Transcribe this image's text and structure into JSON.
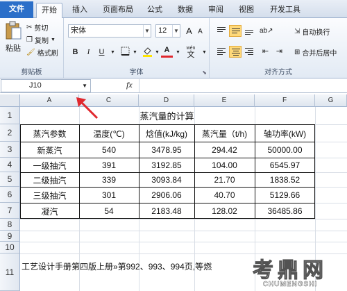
{
  "tabs": [
    "文件",
    "开始",
    "插入",
    "页面布局",
    "公式",
    "数据",
    "审阅",
    "视图",
    "开发工具"
  ],
  "clipboard": {
    "paste": "粘贴",
    "cut": "剪切",
    "copy": "复制",
    "format_painter": "格式刷",
    "label": "剪贴板"
  },
  "font": {
    "name": "宋体",
    "size": "12",
    "bold": "B",
    "italic": "I",
    "underline": "U",
    "grow": "A",
    "shrink": "A",
    "color_a": "A",
    "wen": "wén",
    "label": "字体"
  },
  "alignment": {
    "wrap": "自动换行",
    "merge": "合并后居中",
    "label": "对齐方式"
  },
  "formula_bar": {
    "cell_ref": "J10",
    "fx": "fx",
    "value": ""
  },
  "columns": [
    "A",
    "C",
    "D",
    "E",
    "F",
    "G"
  ],
  "rows": [
    "1",
    "2",
    "3",
    "4",
    "5",
    "6",
    "7",
    "8",
    "9",
    "10",
    "11"
  ],
  "sheet": {
    "title": "蒸汽量的计算",
    "headers": [
      "蒸汽参数",
      "温度(℃)",
      "焓值(kJ/kg)",
      "蒸汽量（t/h)",
      "轴功率(kW)"
    ],
    "data": [
      [
        "新蒸汽",
        "540",
        "3478.95",
        "294.42",
        "50000.00"
      ],
      [
        "一级抽汽",
        "391",
        "3192.85",
        "104.00",
        "6545.97"
      ],
      [
        "二级抽汽",
        "339",
        "3093.84",
        "21.70",
        "1838.52"
      ],
      [
        "三级抽汽",
        "301",
        "2906.06",
        "40.70",
        "5129.66"
      ],
      [
        "凝汽",
        "54",
        "2183.48",
        "128.02",
        "36485.86"
      ]
    ],
    "row11_text": "工艺设计手册第四版上册»第992、993、994页,等燃"
  },
  "watermark": {
    "brand_cn": "考鼎网",
    "brand_en": "CHUMENGSHI"
  },
  "colors": {
    "file_tab": "#2b6fc9",
    "red_arrow": "#e0282e",
    "highlight": "#ffd97a"
  }
}
